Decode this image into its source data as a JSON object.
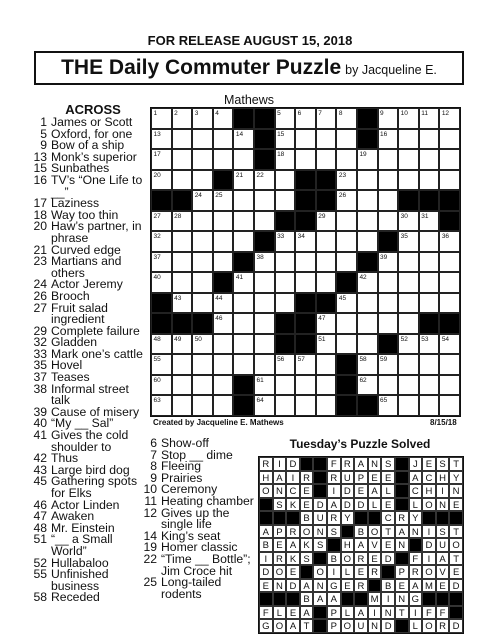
{
  "release": "FOR RELEASE AUGUST 15, 2018",
  "title": "THE Daily Commuter Puzzle",
  "byline": "by Jacqueline E. Mathews",
  "across": {
    "heading": "ACROSS",
    "clues": [
      {
        "n": "1",
        "t": "James or Scott"
      },
      {
        "n": "5",
        "t": "Oxford, for one"
      },
      {
        "n": "9",
        "t": "Bow of a ship"
      },
      {
        "n": "13",
        "t": "Monk’s superior"
      },
      {
        "n": "15",
        "t": "Sunbathes"
      },
      {
        "n": "16",
        "t": "TV’s “One Life to __”"
      },
      {
        "n": "17",
        "t": "Laziness"
      },
      {
        "n": "18",
        "t": "Way too thin"
      },
      {
        "n": "20",
        "t": "Haw’s partner, in phrase"
      },
      {
        "n": "21",
        "t": "Curved edge"
      },
      {
        "n": "23",
        "t": "Martians and others"
      },
      {
        "n": "24",
        "t": "Actor Jeremy"
      },
      {
        "n": "26",
        "t": "Brooch"
      },
      {
        "n": "27",
        "t": "Fruit salad ingredient"
      },
      {
        "n": "29",
        "t": "Complete failure"
      },
      {
        "n": "32",
        "t": "Gladden"
      },
      {
        "n": "33",
        "t": "Mark one’s cattle"
      },
      {
        "n": "35",
        "t": "Hovel"
      },
      {
        "n": "37",
        "t": "Teases"
      },
      {
        "n": "38",
        "t": "Informal street talk"
      },
      {
        "n": "39",
        "t": "Cause of misery"
      },
      {
        "n": "40",
        "t": "“My __ Sal”"
      },
      {
        "n": "41",
        "t": "Gives the cold shoulder to"
      },
      {
        "n": "42",
        "t": "Thus"
      },
      {
        "n": "43",
        "t": "Large bird dog"
      },
      {
        "n": "45",
        "t": "Gathering spots for Elks"
      },
      {
        "n": "46",
        "t": "Actor Linden"
      },
      {
        "n": "47",
        "t": "Awaken"
      },
      {
        "n": "48",
        "t": "Mr. Einstein"
      },
      {
        "n": "51",
        "t": "“__ a Small World”"
      },
      {
        "n": "52",
        "t": "Hullabaloo"
      },
      {
        "n": "55",
        "t": "Unfinished business"
      },
      {
        "n": "58",
        "t": "Receded"
      }
    ]
  },
  "down": {
    "clues": [
      {
        "n": "6",
        "t": "Show-off"
      },
      {
        "n": "7",
        "t": "Stop __ dime"
      },
      {
        "n": "8",
        "t": "Fleeing"
      },
      {
        "n": "9",
        "t": "Prairies"
      },
      {
        "n": "10",
        "t": "Ceremony"
      },
      {
        "n": "11",
        "t": "Heating chamber"
      },
      {
        "n": "12",
        "t": "Gives up the single life"
      },
      {
        "n": "14",
        "t": "King’s seat"
      },
      {
        "n": "19",
        "t": "Homer classic"
      },
      {
        "n": "22",
        "t": "“Time __ Bottle”; Jim Croce hit"
      },
      {
        "n": "25",
        "t": "Long-tailed rodents"
      }
    ]
  },
  "puzzle_grid": [
    "....##....#....",
    ".....#....#....",
    ".....#.........",
    "...#...##......",
    "##.....##...###",
    "......##......#",
    ".....#.....#...",
    "....#.....#....",
    "...#.....#.....",
    "#......##......",
    "###...##.....##",
    "......##...#...",
    ".........#.....",
    "....#....#.....",
    "....#....##...."
  ],
  "credit": "Created by Jacqueline E. Mathews",
  "date": "8/15/18",
  "solved": {
    "title": "Tuesday’s Puzzle Solved",
    "rows": [
      "RID##FRANS#JEST",
      "HAIR#RUPEE#ACHY",
      "ONCE#IDEAL#CHIN",
      "#SKEDADDLE#LONE",
      "###BURY##CRY###",
      "APRONS#BOTANIST",
      "BEAKS#HAVEN#DUO",
      "IRKS#BORED#FIAT",
      "DOE#OILER#PROVE",
      "ENDANGER#BEAMED",
      "###BAA##MING###",
      "FLEA#PLAINTIFF#",
      "GOAT#POUND#LORD"
    ]
  }
}
